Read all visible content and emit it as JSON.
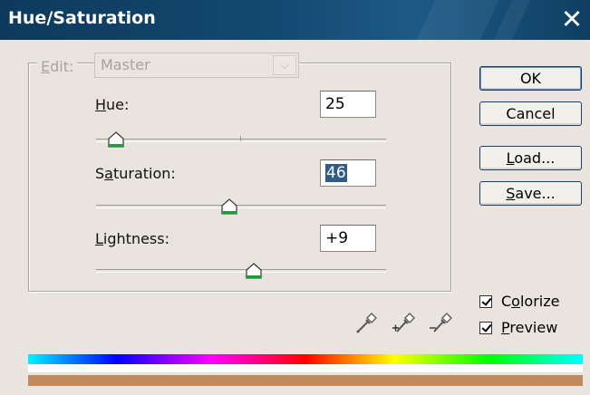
{
  "window": {
    "title": "Hue/Saturation",
    "close_glyph": "✕"
  },
  "edit": {
    "label_prefix": "E",
    "label_rest": "dit:",
    "selected": "Master"
  },
  "sliders": [
    {
      "label_pre": "",
      "label_u": "H",
      "label_post": "ue:",
      "value": "25",
      "level": 0.07
    },
    {
      "label_pre": "S",
      "label_u": "a",
      "label_post": "turation:",
      "value": "46",
      "level": 0.46
    },
    {
      "label_pre": "",
      "label_u": "L",
      "label_post": "ightness:",
      "value": "+9",
      "level": 0.545
    }
  ],
  "buttons": {
    "ok": "OK",
    "cancel": "Cancel",
    "load_u": "L",
    "load_rest": "oad...",
    "save_u": "S",
    "save_rest": "ave..."
  },
  "checkboxes": {
    "colorize_pre": "C",
    "colorize_u": "o",
    "colorize_rest": "lorize",
    "colorize_checked": true,
    "preview_u": "P",
    "preview_rest": "review",
    "preview_checked": true
  },
  "colors": {
    "title_bar": "#13486f",
    "dialog_bg": "#e9e5de",
    "result_color": "#c08a5a"
  }
}
